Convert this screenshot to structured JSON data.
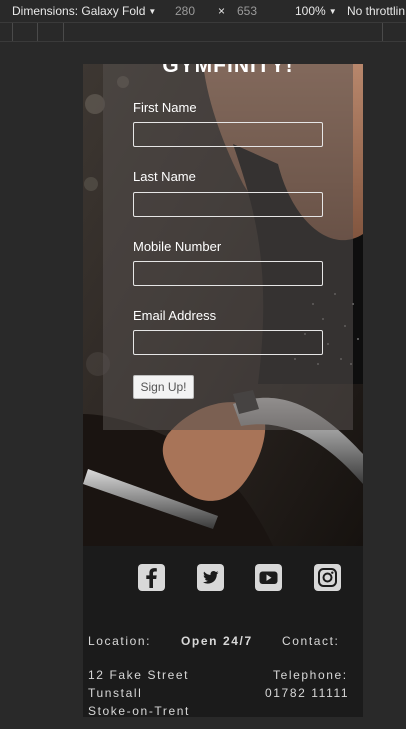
{
  "devtools": {
    "device_label": "Dimensions: Galaxy Fold",
    "width": "280",
    "times": "×",
    "height": "653",
    "zoom": "100%",
    "throttling": "No throttlin"
  },
  "form": {
    "title": "GYMFINITY!",
    "fields": [
      {
        "label": "First Name",
        "value": ""
      },
      {
        "label": "Last Name",
        "value": ""
      },
      {
        "label": "Mobile Number",
        "value": ""
      },
      {
        "label": "Email Address",
        "value": ""
      }
    ],
    "submit_label": "Sign Up!"
  },
  "social": [
    "facebook-icon",
    "twitter-icon",
    "youtube-icon",
    "instagram-icon"
  ],
  "footer": {
    "location_label": "Location:",
    "hours_label": "Open 24/7",
    "contact_label": "Contact:",
    "address": [
      "12 Fake Street",
      "Tunstall",
      "Stoke-on-Trent"
    ],
    "telephone_label": "Telephone:",
    "telephone": "01782 11111"
  },
  "colors": {
    "page_bg": "#292929",
    "footer_bg": "#1b1b1b",
    "icon_fill": "#d8d8d8",
    "form_overlay": "rgba(85,80,78,0.55)"
  }
}
